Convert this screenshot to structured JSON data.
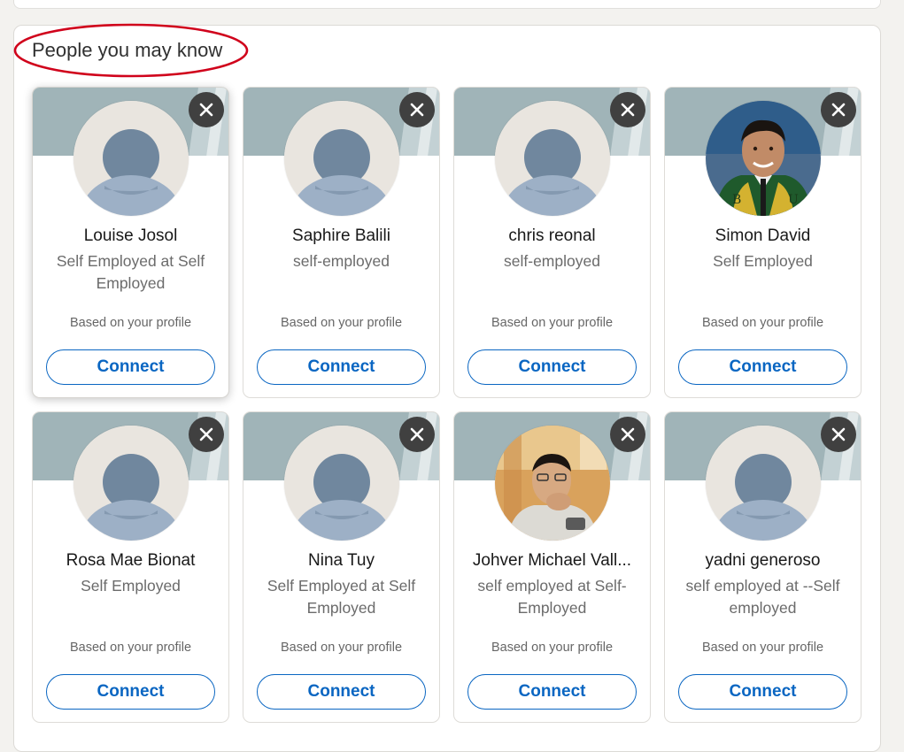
{
  "section": {
    "title": "People you may know",
    "highlight_color": "#d0021b"
  },
  "colors": {
    "accent": "#0a66c2",
    "cover": "#a0b4b8"
  },
  "cards": [
    {
      "name": "Louise Josol",
      "headline": "Self Employed at Self Employed",
      "reason": "Based on your profile",
      "connect_label": "Connect",
      "photo": "default-avatar"
    },
    {
      "name": "Saphire Balili",
      "headline": "self-employed",
      "reason": "Based on your profile",
      "connect_label": "Connect",
      "photo": "default-avatar"
    },
    {
      "name": "chris reonal",
      "headline": "self-employed",
      "reason": "Based on your profile",
      "connect_label": "Connect",
      "photo": "default-avatar"
    },
    {
      "name": "Simon David",
      "headline": "Self Employed",
      "reason": "Based on your profile",
      "connect_label": "Connect",
      "photo": "graduation-portrait"
    },
    {
      "name": "Rosa Mae Bionat",
      "headline": "Self Employed",
      "reason": "Based on your profile",
      "connect_label": "Connect",
      "photo": "default-avatar"
    },
    {
      "name": "Nina Tuy",
      "headline": "Self Employed at Self Employed",
      "reason": "Based on your profile",
      "connect_label": "Connect",
      "photo": "default-avatar"
    },
    {
      "name": "Johver Michael Vall...",
      "headline": "self employed at Self-Employed",
      "reason": "Based on your profile",
      "connect_label": "Connect",
      "photo": "casual-portrait"
    },
    {
      "name": "yadni generoso",
      "headline": "self employed at --Self employed",
      "reason": "Based on your profile",
      "connect_label": "Connect",
      "photo": "default-avatar"
    }
  ]
}
